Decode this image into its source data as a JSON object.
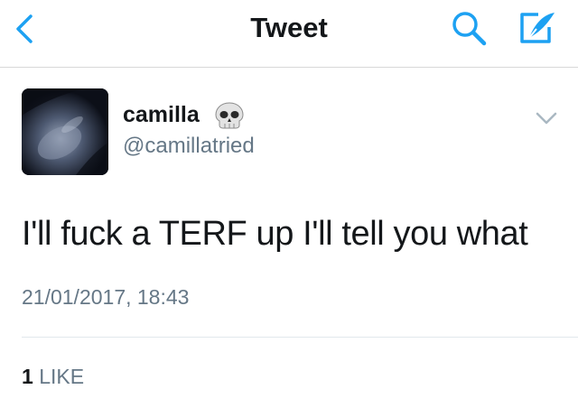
{
  "nav": {
    "title": "Tweet",
    "accent": "#1da1f2"
  },
  "tweet": {
    "author": {
      "display_name": "camilla",
      "display_emoji": "skull-emoji",
      "handle": "@camillatried"
    },
    "text": "I'll fuck a TERF up I'll tell you what",
    "timestamp": "21/01/2017, 18:43",
    "likes": {
      "count": "1",
      "label": "LIKE"
    }
  },
  "icons": {
    "back": "chevron-left-icon",
    "search": "search-icon",
    "compose": "compose-icon",
    "more": "chevron-down-icon"
  }
}
